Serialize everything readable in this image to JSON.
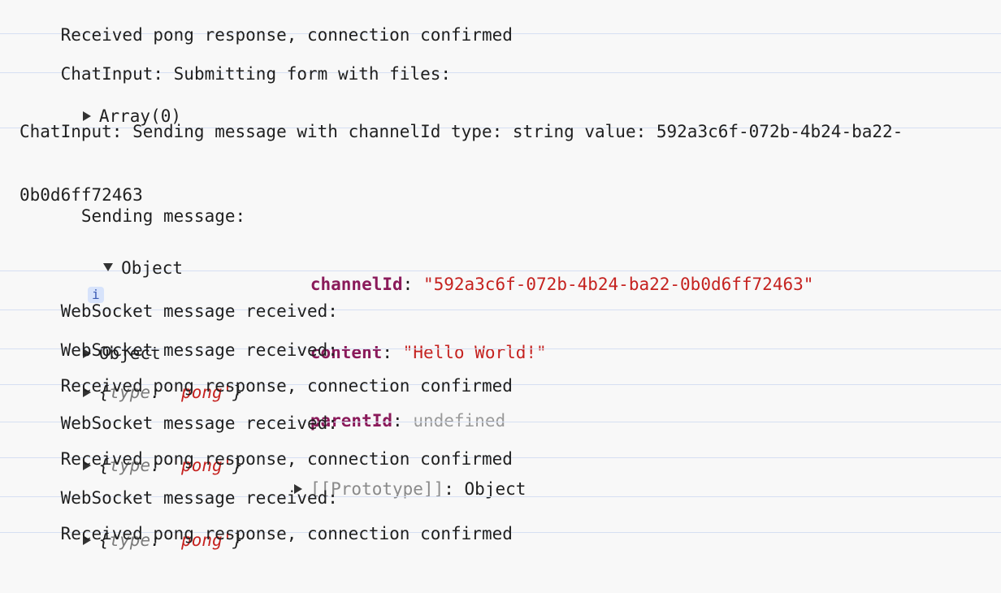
{
  "console": {
    "entries": [
      {
        "text": "Received pong response, connection confirmed"
      },
      {
        "label": "ChatInput: Submitting form with files:",
        "value": "Array(0)"
      },
      {
        "line1": "ChatInput: Sending message with channelId type: string value: 592a3c6f-072b-4b24-ba22-",
        "line2": "0b0d6ff72463"
      },
      {
        "label": "Sending message:",
        "object_label": "Object",
        "info_icon": "i",
        "props": [
          {
            "key": "channelId",
            "value": "\"592a3c6f-072b-4b24-ba22-0b0d6ff72463\""
          },
          {
            "key": "content",
            "value": "\"Hello World!\""
          },
          {
            "key": "parentId",
            "value": "undefined"
          }
        ],
        "prototype_key": "[[Prototype]]",
        "prototype_value": "Object"
      },
      {
        "label": "WebSocket message received:",
        "value": "Object"
      },
      {
        "label": "WebSocket message received:",
        "obj_open": "{",
        "obj_key": "type",
        "obj_colon": ":",
        "obj_value": "'pong'",
        "obj_close": "}"
      },
      {
        "text": "Received pong response, connection confirmed"
      },
      {
        "label": "WebSocket message received:",
        "obj_open": "{",
        "obj_key": "type",
        "obj_colon": ":",
        "obj_value": "'pong'",
        "obj_close": "}"
      },
      {
        "text": "Received pong response, connection confirmed"
      },
      {
        "label": "WebSocket message received:",
        "obj_open": "{",
        "obj_key": "type",
        "obj_colon": ":",
        "obj_value": "'pong'",
        "obj_close": "}"
      },
      {
        "text": "Received pong response, connection confirmed"
      }
    ]
  },
  "colors": {
    "background": "#f8f8f8",
    "divider": "#d6dff2",
    "key": "#8a1a5a",
    "string": "#c5221f",
    "undefined": "#9a9a9a"
  },
  "icons": {
    "collapsed": "disclosure-triangle-right",
    "expanded": "disclosure-triangle-down",
    "info": "info-badge"
  }
}
